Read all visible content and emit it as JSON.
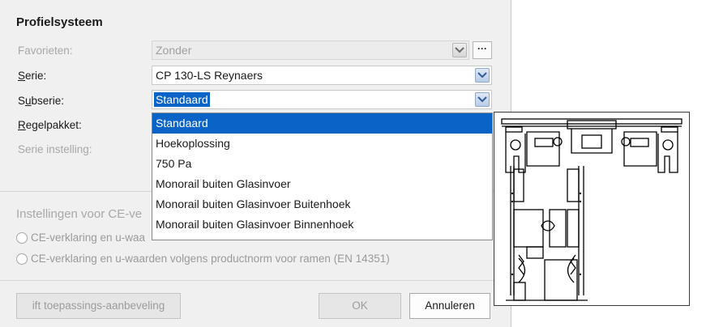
{
  "section": {
    "title": "Profielsysteem"
  },
  "fields": {
    "favorieten": {
      "label": "Favorieten:",
      "value": "Zonder",
      "more": "···"
    },
    "serie": {
      "label_underlined": "S",
      "label_rest": "erie:",
      "value": "CP 130-LS Reynaers"
    },
    "subserie": {
      "label_pre": "S",
      "label_underlined": "u",
      "label_rest": "bserie:",
      "value": "Standaard"
    },
    "regelpakket": {
      "label_underlined": "R",
      "label_rest": "egelpakket:"
    },
    "serie_instelling": {
      "label": "Serie instelling:"
    }
  },
  "dropdown": {
    "options": [
      "Standaard",
      "Hoekoplossing",
      "750 Pa",
      "Monorail buiten Glasinvoer",
      "Monorail buiten Glasinvoer Buitenhoek",
      "Monorail buiten Glasinvoer Binnenhoek"
    ],
    "selected_index": 0
  },
  "ce": {
    "title": "Instellingen voor CE-ve",
    "option1": "CE-verklaring en u-waa",
    "option2": "CE-verklaring en u-waarden volgens productnorm voor ramen (EN 14351)"
  },
  "buttons": {
    "recommendation": "ift toepassings-aanbeveling",
    "ok": "OK",
    "cancel": "Annuleren"
  },
  "icons": {
    "chevron": "chevron-down-icon",
    "profile": "profile-section-drawing"
  },
  "colors": {
    "selection": "#0a64c8",
    "dialog_bg": "#f0f0f0"
  }
}
